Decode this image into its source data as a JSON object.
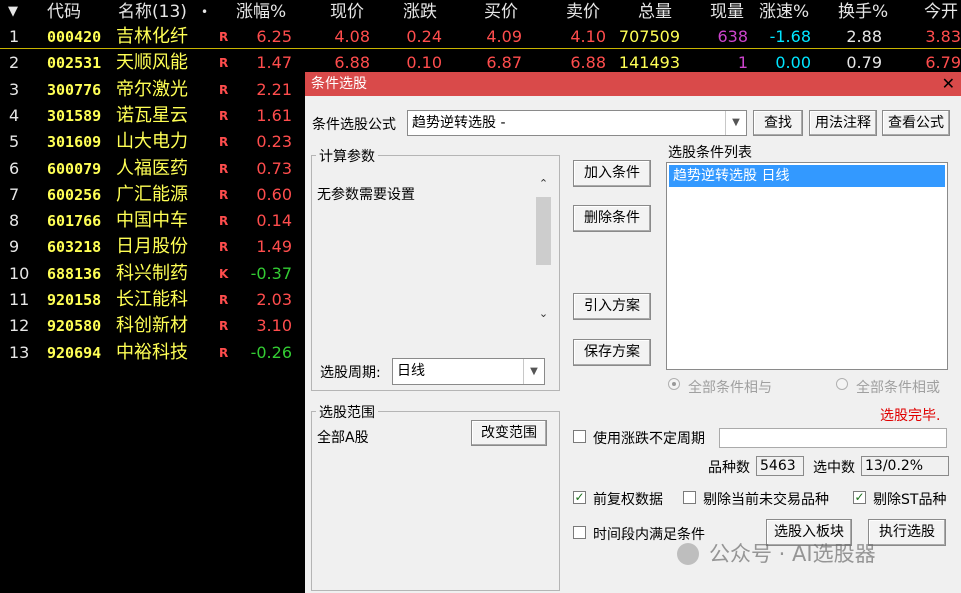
{
  "header": [
    "代码",
    "名称(13)",
    "涨幅%",
    "现价",
    "涨跌",
    "买价",
    "卖价",
    "总量",
    "现量",
    "涨速%",
    "换手%",
    "今开"
  ],
  "header_dot": "•",
  "header_arrow": "▼",
  "rows": [
    {
      "idx": "1",
      "code": "000420",
      "name": "吉林化纤",
      "flag": "R",
      "chg": "6.25",
      "price": "4.08",
      "diff": "0.24",
      "bid": "4.09",
      "ask": "4.10",
      "vol": "707509",
      "cur": "638",
      "spd": "-1.68",
      "turn": "2.88",
      "open": "3.83"
    },
    {
      "idx": "2",
      "code": "002531",
      "name": "天顺风能",
      "flag": "R",
      "chg": "1.47",
      "price": "6.88",
      "diff": "0.10",
      "bid": "6.87",
      "ask": "6.88",
      "vol": "141493",
      "cur": "1",
      "spd": "0.00",
      "turn": "0.79",
      "open": "6.79"
    },
    {
      "idx": "3",
      "code": "300776",
      "name": "帝尔激光",
      "flag": "R",
      "chg": "2.21"
    },
    {
      "idx": "4",
      "code": "301589",
      "name": "诺瓦星云",
      "flag": "R",
      "chg": "1.61"
    },
    {
      "idx": "5",
      "code": "301609",
      "name": "山大电力",
      "flag": "R",
      "chg": "0.23"
    },
    {
      "idx": "6",
      "code": "600079",
      "name": "人福医药",
      "flag": "R",
      "chg": "0.73"
    },
    {
      "idx": "7",
      "code": "600256",
      "name": "广汇能源",
      "flag": "R",
      "chg": "0.60"
    },
    {
      "idx": "8",
      "code": "601766",
      "name": "中国中车",
      "flag": "R",
      "chg": "0.14"
    },
    {
      "idx": "9",
      "code": "603218",
      "name": "日月股份",
      "flag": "R",
      "chg": "1.49"
    },
    {
      "idx": "10",
      "code": "688136",
      "name": "科兴制药",
      "flag": "K",
      "chg": "-0.37"
    },
    {
      "idx": "11",
      "code": "920158",
      "name": "长江能科",
      "flag": "R",
      "chg": "2.03"
    },
    {
      "idx": "12",
      "code": "920580",
      "name": "科创新材",
      "flag": "R",
      "chg": "3.10"
    },
    {
      "idx": "13",
      "code": "920694",
      "name": "中裕科技",
      "flag": "R",
      "chg": "-0.26"
    }
  ],
  "colors": {
    "up": "#ff4d4d",
    "down": "#33cc33",
    "code": "#ffff55",
    "vol": "#ffff55",
    "cur": "#cc44cc",
    "spd": "#00e5ff",
    "neutral": "#e6e6e6",
    "titlebar": "#d94a4a",
    "selection": "#3399ff"
  },
  "dialog": {
    "title": "条件选股",
    "close": "✕",
    "formula_label": "条件选股公式",
    "formula_value": "趋势逆转选股  -",
    "find_btn": "查找",
    "usage_btn": "用法注释",
    "view_btn": "查看公式",
    "params_title": "计算参数",
    "params_text": "无参数需要设置",
    "period_label": "选股周期:",
    "period_value": "日线",
    "add_btn": "加入条件",
    "del_btn": "删除条件",
    "import_btn": "引入方案",
    "save_btn": "保存方案",
    "list_title": "选股条件列表",
    "list_items": [
      "趋势逆转选股  日线"
    ],
    "radio_and": "全部条件相与",
    "radio_or": "全部条件相或",
    "status": "选股完毕.",
    "range_title": "选股范围",
    "range_value": "全部A股",
    "change_range_btn": "改变范围",
    "use_label": "使用涨跌不定周期",
    "count_label": "品种数",
    "count_value": "5463",
    "hit_label": "选中数",
    "hit_value": "13/0.2%",
    "cb_fq": "前复权数据",
    "cb_notrade": "剔除当前未交易品种",
    "cb_st": "剔除ST品种",
    "cb_time": "时间段内满足条件",
    "to_block_btn": "选股入板块",
    "run_btn": "执行选股",
    "watermark": "公众号 · AI选股器"
  }
}
